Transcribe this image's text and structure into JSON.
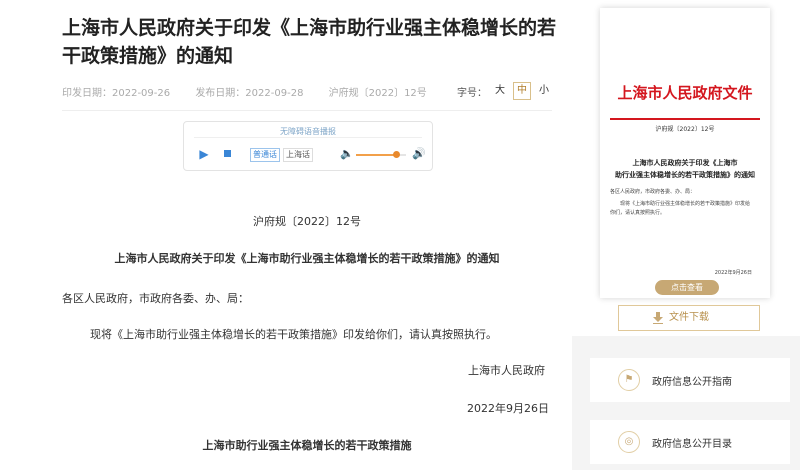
{
  "article": {
    "title": "上海市人民政府关于印发《上海市助行业强主体稳增长的若干政策措施》的通知",
    "meta": {
      "publish_date": "印发日期：2022-09-26",
      "release_date": "发布日期：2022-09-28",
      "doc_number": "沪府规〔2022〕12号"
    },
    "font_size": {
      "label": "字号：",
      "options": [
        "大",
        "中",
        "小"
      ],
      "selected": "中"
    }
  },
  "player": {
    "title": "无障碍语音播报",
    "lang_options": [
      "普通话",
      "上海话"
    ],
    "selected_lang": "普通话",
    "volume": 0.8,
    "play_icon": "play-icon",
    "stop_icon": "stop-icon"
  },
  "body": {
    "doc_no": "沪府规〔2022〕12号",
    "notice_title": "上海市人民政府关于印发《上海市助行业强主体稳增长的若干政策措施》的通知",
    "salutation": "各区人民政府，市政府各委、办、局：",
    "paragraph": "现将《上海市助行业强主体稳增长的若干政策措施》印发给你们，请认真按照执行。",
    "issuer": "上海市人民政府",
    "issue_date": "2022年9月26日",
    "measures_title": "上海市助行业强主体稳增长的若干政策措施"
  },
  "sidebar": {
    "preview": {
      "header": "上海市人民政府文件",
      "doc_no": "沪府规〔2022〕12号",
      "title_line1": "上海市人民政府关于印发《上海市",
      "title_line2": "助行业强主体稳增长的若干政策措施》的通知",
      "line1": "各区人民政府，市政府各委、办、局：",
      "line2": "现将《上海市助行业强主体稳增长的若干政策措施》印发给",
      "line3": "你们，请认真按照执行。",
      "date": "2022年9月26日"
    },
    "view_button": "点击查看",
    "download_button": "文件下载",
    "links": [
      {
        "label": "政府信息公开指南",
        "icon": "guide-icon"
      },
      {
        "label": "政府信息公开目录",
        "icon": "catalog-icon"
      }
    ],
    "colors": {
      "red": "#d4161e",
      "gold": "#c7a874",
      "link_blue": "#3a86d6"
    }
  }
}
